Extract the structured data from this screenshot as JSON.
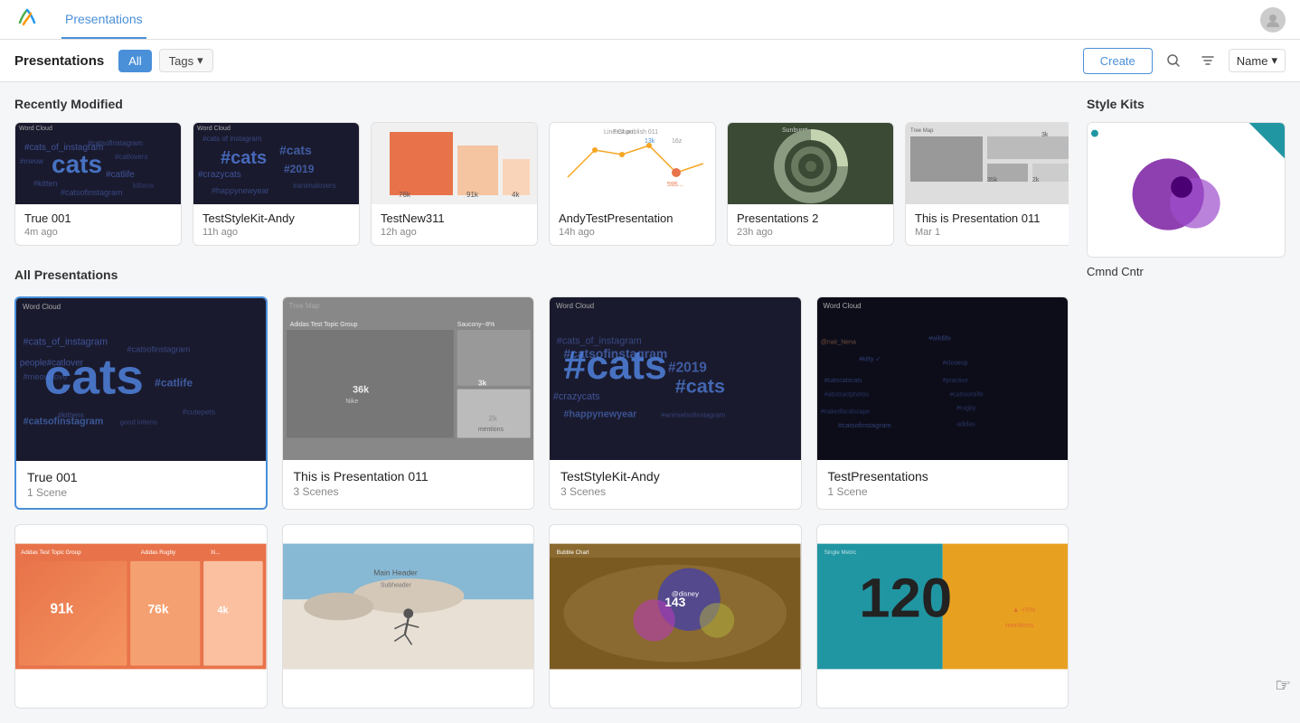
{
  "topNav": {
    "tabs": [
      {
        "id": "presentations",
        "label": "Presentations",
        "active": true
      }
    ],
    "logo_alt": "Logo"
  },
  "subHeader": {
    "title": "Presentations",
    "filters": [
      {
        "id": "all",
        "label": "All",
        "active": true
      },
      {
        "id": "tags",
        "label": "Tags",
        "active": false,
        "hasDropdown": true
      }
    ],
    "createLabel": "Create",
    "sortLabel": "Name"
  },
  "recentlyModified": {
    "sectionTitle": "Recently Modified",
    "cards": [
      {
        "id": "rc1",
        "name": "True 001",
        "time": "4m ago",
        "thumbType": "wordcloud-dark"
      },
      {
        "id": "rc2",
        "name": "TestStyleKit-Andy",
        "time": "11h ago",
        "thumbType": "wordcloud-dark2"
      },
      {
        "id": "rc3",
        "name": "TestNew311",
        "time": "12h ago",
        "thumbType": "gradient-orange"
      },
      {
        "id": "rc4",
        "name": "AndyTestPresentation",
        "time": "14h ago",
        "thumbType": "linechart"
      },
      {
        "id": "rc5",
        "name": "Presentations 2",
        "time": "23h ago",
        "thumbType": "sunburst"
      },
      {
        "id": "rc6",
        "name": "This is Presentation 011",
        "time": "Mar 1",
        "thumbType": "treemap-gray"
      }
    ]
  },
  "styleKits": {
    "sectionTitle": "Style Kits",
    "cards": [
      {
        "id": "sk1",
        "name": "Cmnd Cntr",
        "thumbType": "circles-blue"
      }
    ]
  },
  "allPresentations": {
    "sectionTitle": "All Presentations",
    "cards": [
      {
        "id": "p1",
        "name": "True 001",
        "meta": "1 Scene",
        "thumbType": "wordcloud-dark",
        "selected": true
      },
      {
        "id": "p2",
        "name": "This is Presentation 011",
        "meta": "3 Scenes",
        "thumbType": "treemap-dark"
      },
      {
        "id": "p3",
        "name": "TestStyleKit-Andy",
        "meta": "3 Scenes",
        "thumbType": "wordcloud-dark3"
      },
      {
        "id": "p4",
        "name": "TestPresentations",
        "meta": "1 Scene",
        "thumbType": "wordcloud-dark4"
      },
      {
        "id": "p5",
        "name": "",
        "meta": "",
        "thumbType": "treemap-orange"
      },
      {
        "id": "p6",
        "name": "",
        "meta": "",
        "thumbType": "photo-snow"
      },
      {
        "id": "p7",
        "name": "",
        "meta": "",
        "thumbType": "bubble-chart"
      },
      {
        "id": "p8",
        "name": "",
        "meta": "",
        "thumbType": "single-metric"
      }
    ]
  }
}
